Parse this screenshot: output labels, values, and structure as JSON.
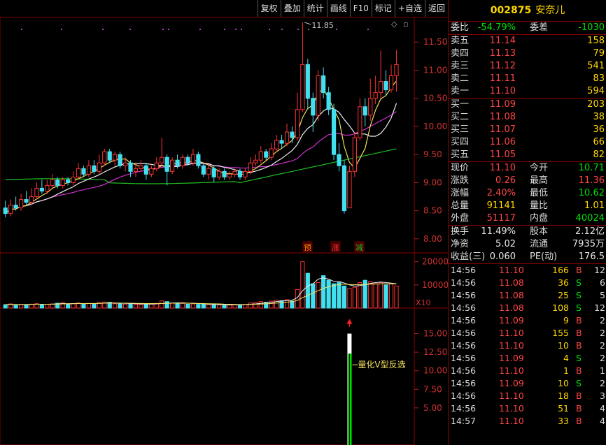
{
  "toolbar": {
    "buttons": [
      "复权",
      "叠加",
      "统计",
      "画线",
      "F10",
      "标记",
      "+自选",
      "返回"
    ]
  },
  "stock": {
    "code": "002875",
    "name": "安奈儿"
  },
  "wei": {
    "bi_label": "委比",
    "bi_value": "-54.79%",
    "cha_label": "委差",
    "cha_value": "-1030"
  },
  "asks": [
    {
      "label": "卖五",
      "price": "11.14",
      "vol": "158"
    },
    {
      "label": "卖四",
      "price": "11.13",
      "vol": "79"
    },
    {
      "label": "卖三",
      "price": "11.12",
      "vol": "541"
    },
    {
      "label": "卖二",
      "price": "11.11",
      "vol": "83"
    },
    {
      "label": "卖一",
      "price": "11.10",
      "vol": "594"
    }
  ],
  "bids": [
    {
      "label": "买一",
      "price": "11.09",
      "vol": "203"
    },
    {
      "label": "买二",
      "price": "11.08",
      "vol": "38"
    },
    {
      "label": "买三",
      "price": "11.07",
      "vol": "36"
    },
    {
      "label": "买四",
      "price": "11.06",
      "vol": "66"
    },
    {
      "label": "买五",
      "price": "11.05",
      "vol": "82"
    }
  ],
  "quote": [
    {
      "l1": "现价",
      "v1": "11.10",
      "c1": "red",
      "l2": "今开",
      "v2": "10.71",
      "c2": "green"
    },
    {
      "l1": "涨跌",
      "v1": "0.26",
      "c1": "red",
      "l2": "最高",
      "v2": "11.36",
      "c2": "red"
    },
    {
      "l1": "涨幅",
      "v1": "2.40%",
      "c1": "red",
      "l2": "最低",
      "v2": "10.62",
      "c2": "green"
    },
    {
      "l1": "总量",
      "v1": "91141",
      "c1": "yel",
      "l2": "量比",
      "v2": "1.01",
      "c2": "yel"
    },
    {
      "l1": "外盘",
      "v1": "51117",
      "c1": "red",
      "l2": "内盘",
      "v2": "40024",
      "c2": "green"
    }
  ],
  "fund": [
    {
      "l1": "换手",
      "v1": "11.49%",
      "l2": "股本",
      "v2": "2.12亿"
    },
    {
      "l1": "净资",
      "v1": "5.02",
      "l2": "流通",
      "v2": "7935万"
    },
    {
      "l1": "收益(三)",
      "v1": "0.060",
      "l2": "PE(动)",
      "v2": "176.5"
    }
  ],
  "ticks": [
    {
      "time": "14:56",
      "price": "11.10",
      "vol": "166",
      "side": "B",
      "num": "12"
    },
    {
      "time": "14:56",
      "price": "11.08",
      "vol": "36",
      "side": "S",
      "num": "6"
    },
    {
      "time": "14:56",
      "price": "11.08",
      "vol": "25",
      "side": "S",
      "num": "5"
    },
    {
      "time": "14:56",
      "price": "11.08",
      "vol": "108",
      "side": "S",
      "num": "12"
    },
    {
      "time": "14:56",
      "price": "11.09",
      "vol": "9",
      "side": "B",
      "num": "2"
    },
    {
      "time": "14:56",
      "price": "11.10",
      "vol": "155",
      "side": "B",
      "num": "2"
    },
    {
      "time": "14:56",
      "price": "11.10",
      "vol": "10",
      "side": "B",
      "num": "2"
    },
    {
      "time": "14:56",
      "price": "11.09",
      "vol": "4",
      "side": "S",
      "num": "2"
    },
    {
      "time": "14:56",
      "price": "11.10",
      "vol": "1",
      "side": "B",
      "num": "1"
    },
    {
      "time": "14:56",
      "price": "11.09",
      "vol": "10",
      "side": "S",
      "num": "2"
    },
    {
      "time": "14:56",
      "price": "11.10",
      "vol": "18",
      "side": "B",
      "num": "3"
    },
    {
      "time": "14:56",
      "price": "11.10",
      "vol": "51",
      "side": "B",
      "num": "4"
    },
    {
      "time": "14:57",
      "price": "11.10",
      "vol": "33",
      "side": "B",
      "num": "4"
    }
  ],
  "chart_data": {
    "type": "candlestick",
    "price_axis": {
      "ticks": [
        "11.50",
        "11.00",
        "10.50",
        "10.00",
        "9.50",
        "9.00",
        "8.50",
        "8.00"
      ],
      "range": [
        7.75,
        11.95
      ]
    },
    "high_label": "11.85",
    "signal_tags": [
      "预",
      "涨",
      "减"
    ],
    "volume_axis": {
      "ticks": [
        "20000",
        "10000"
      ],
      "unit_label": "X10",
      "max": 22000
    },
    "indicator_axis": {
      "ticks": [
        "15.00",
        "12.50",
        "10.00",
        "7.50",
        "5.00"
      ],
      "range": [
        0,
        17.5
      ]
    },
    "indicator_label": "量化V型反选",
    "candles": [
      [
        8.55,
        8.45,
        8.68,
        8.38
      ],
      [
        8.45,
        8.6,
        8.7,
        8.4
      ],
      [
        8.6,
        8.55,
        8.75,
        8.5
      ],
      [
        8.55,
        8.7,
        8.8,
        8.5
      ],
      [
        8.7,
        8.65,
        8.85,
        8.6
      ],
      [
        8.65,
        8.75,
        8.9,
        8.6
      ],
      [
        8.75,
        8.9,
        9.0,
        8.7
      ],
      [
        8.9,
        8.85,
        9.05,
        8.8
      ],
      [
        8.85,
        8.95,
        9.05,
        8.8
      ],
      [
        8.95,
        9.05,
        9.15,
        8.9
      ],
      [
        9.05,
        8.95,
        9.1,
        8.9
      ],
      [
        8.95,
        9.05,
        9.1,
        8.9
      ],
      [
        9.05,
        9.0,
        9.1,
        8.95
      ],
      [
        9.0,
        9.1,
        9.2,
        8.95
      ],
      [
        9.1,
        9.25,
        9.35,
        9.05
      ],
      [
        9.25,
        9.15,
        9.3,
        9.1
      ],
      [
        9.15,
        9.3,
        9.4,
        9.1
      ],
      [
        9.3,
        9.2,
        9.4,
        9.15
      ],
      [
        9.2,
        9.35,
        9.5,
        9.15
      ],
      [
        9.35,
        9.55,
        9.6,
        9.3
      ],
      [
        9.55,
        9.4,
        9.6,
        9.35
      ],
      [
        9.4,
        9.5,
        9.55,
        9.3
      ],
      [
        9.5,
        9.3,
        9.55,
        9.25
      ],
      [
        9.3,
        9.35,
        9.45,
        9.2
      ],
      [
        9.35,
        9.2,
        9.4,
        9.1
      ],
      [
        9.2,
        9.25,
        9.35,
        9.1
      ],
      [
        9.25,
        9.3,
        9.4,
        9.2
      ],
      [
        9.3,
        9.15,
        9.35,
        9.05
      ],
      [
        9.15,
        9.25,
        9.3,
        9.1
      ],
      [
        9.25,
        9.35,
        9.45,
        9.2
      ],
      [
        9.35,
        9.45,
        9.8,
        9.3
      ],
      [
        9.45,
        9.2,
        9.5,
        8.95
      ],
      [
        9.2,
        9.4,
        9.45,
        9.15
      ],
      [
        9.4,
        9.3,
        9.5,
        9.25
      ],
      [
        9.3,
        9.45,
        9.5,
        9.25
      ],
      [
        9.45,
        9.35,
        9.5,
        9.3
      ],
      [
        9.35,
        9.5,
        9.6,
        9.3
      ],
      [
        9.5,
        9.3,
        9.55,
        9.25
      ],
      [
        9.3,
        9.15,
        9.35,
        9.1
      ],
      [
        9.15,
        9.25,
        9.3,
        9.05
      ],
      [
        9.25,
        9.1,
        9.3,
        9.0
      ],
      [
        9.1,
        9.2,
        9.25,
        9.05
      ],
      [
        9.2,
        9.1,
        9.25,
        9.05
      ],
      [
        9.1,
        9.15,
        9.2,
        9.05
      ],
      [
        9.15,
        9.2,
        9.25,
        9.1
      ],
      [
        9.2,
        9.1,
        9.25,
        9.05
      ],
      [
        9.1,
        9.2,
        9.25,
        9.05
      ],
      [
        9.2,
        9.35,
        9.45,
        9.15
      ],
      [
        9.35,
        9.4,
        9.5,
        9.3
      ],
      [
        9.4,
        9.55,
        9.65,
        9.35
      ],
      [
        9.55,
        9.45,
        9.6,
        9.4
      ],
      [
        9.45,
        9.6,
        9.7,
        9.4
      ],
      [
        9.6,
        9.75,
        9.85,
        9.55
      ],
      [
        9.75,
        9.7,
        9.85,
        9.6
      ],
      [
        9.7,
        9.9,
        10.05,
        9.65
      ],
      [
        9.9,
        9.8,
        10.0,
        9.7
      ],
      [
        9.8,
        10.3,
        10.6,
        9.75
      ],
      [
        10.3,
        11.1,
        11.85,
        10.25
      ],
      [
        11.1,
        10.5,
        11.2,
        10.3
      ],
      [
        10.5,
        10.2,
        10.6,
        9.9
      ],
      [
        10.2,
        10.9,
        11.0,
        10.1
      ],
      [
        10.9,
        10.6,
        11.05,
        10.5
      ],
      [
        10.6,
        10.3,
        10.7,
        10.2
      ],
      [
        10.3,
        9.5,
        10.4,
        9.4
      ],
      [
        9.5,
        9.3,
        9.7,
        9.2
      ],
      [
        9.3,
        8.5,
        9.4,
        8.45
      ],
      [
        8.55,
        9.2,
        9.3,
        8.55
      ],
      [
        9.2,
        9.8,
        9.9,
        9.1
      ],
      [
        9.8,
        10.35,
        10.5,
        9.75
      ],
      [
        10.35,
        10.2,
        10.5,
        10.0
      ],
      [
        10.2,
        10.5,
        10.85,
        10.1
      ],
      [
        10.5,
        10.6,
        10.9,
        10.4
      ],
      [
        10.6,
        10.8,
        11.35,
        10.5
      ],
      [
        10.8,
        10.65,
        11.0,
        10.55
      ],
      [
        10.65,
        10.9,
        11.1,
        10.6
      ],
      [
        10.9,
        11.1,
        11.36,
        10.62
      ]
    ],
    "volumes": [
      1500,
      1800,
      1200,
      1600,
      1400,
      1700,
      1900,
      1500,
      1600,
      1800,
      2100,
      2400,
      1700,
      1900,
      2200,
      1800,
      2000,
      1700,
      2300,
      2600,
      2500,
      1900,
      2000,
      1700,
      1800,
      1600,
      1500,
      1900,
      1700,
      2000,
      3100,
      2800,
      2200,
      1900,
      2000,
      1700,
      1800,
      1600,
      1700,
      1500,
      1600,
      1400,
      1500,
      1300,
      1400,
      1500,
      1600,
      2200,
      2400,
      2800,
      2500,
      3000,
      3400,
      3200,
      3600,
      3000,
      8000,
      20000,
      15000,
      10500,
      11000,
      14000,
      12000,
      10500,
      11000,
      9500,
      8500,
      9000,
      11000,
      12000,
      11500,
      10500,
      11000,
      10000,
      10500,
      9500
    ],
    "volume_ma1": [
      1500,
      1600,
      1500,
      1550,
      1550,
      1600,
      1700,
      1650,
      1650,
      1700,
      1800,
      1950,
      1900,
      1950,
      2000,
      1950,
      1950,
      1950,
      2050,
      2150,
      2250,
      2200,
      2150,
      2050,
      2000,
      1900,
      1800,
      1800,
      1750,
      1800,
      2000,
      2100,
      2200,
      2250,
      2250,
      2150,
      2100,
      1950,
      1850,
      1700,
      1650,
      1550,
      1500,
      1450,
      1450,
      1450,
      1500,
      1650,
      1800,
      2050,
      2300,
      2500,
      2800,
      3100,
      3250,
      3400,
      4500,
      7500,
      9500,
      10500,
      12500,
      13000,
      12500,
      11500,
      11500,
      10800,
      10000,
      9500,
      9700,
      10100,
      10600,
      11000,
      11200,
      11000,
      10800,
      10500
    ],
    "volume_ma2": [
      1500,
      1600,
      1550,
      1550,
      1550,
      1600,
      1650,
      1650,
      1650,
      1700,
      1750,
      1800,
      1850,
      1900,
      1950,
      1950,
      2000,
      2000,
      2050,
      2100,
      2150,
      2150,
      2150,
      2100,
      2100,
      2050,
      2000,
      1950,
      1950,
      1950,
      2000,
      2050,
      2100,
      2100,
      2100,
      2100,
      2050,
      2000,
      1950,
      1900,
      1850,
      1800,
      1700,
      1650,
      1600,
      1550,
      1550,
      1600,
      1650,
      1750,
      1850,
      2000,
      2150,
      2350,
      2550,
      2800,
      3300,
      4500,
      5500,
      6500,
      7500,
      8500,
      9200,
      9800,
      10200,
      10300,
      10200,
      10100,
      10100,
      10200,
      10300,
      10400,
      10500,
      10500,
      10500,
      10400
    ],
    "indicator_bar_index": 66,
    "indicator_bars": [
      {
        "value": 15.0,
        "color": "#ffffff"
      },
      {
        "value": 12.3,
        "color": "#00e000"
      },
      {
        "value": 8.3,
        "color": "#00e000"
      }
    ]
  }
}
